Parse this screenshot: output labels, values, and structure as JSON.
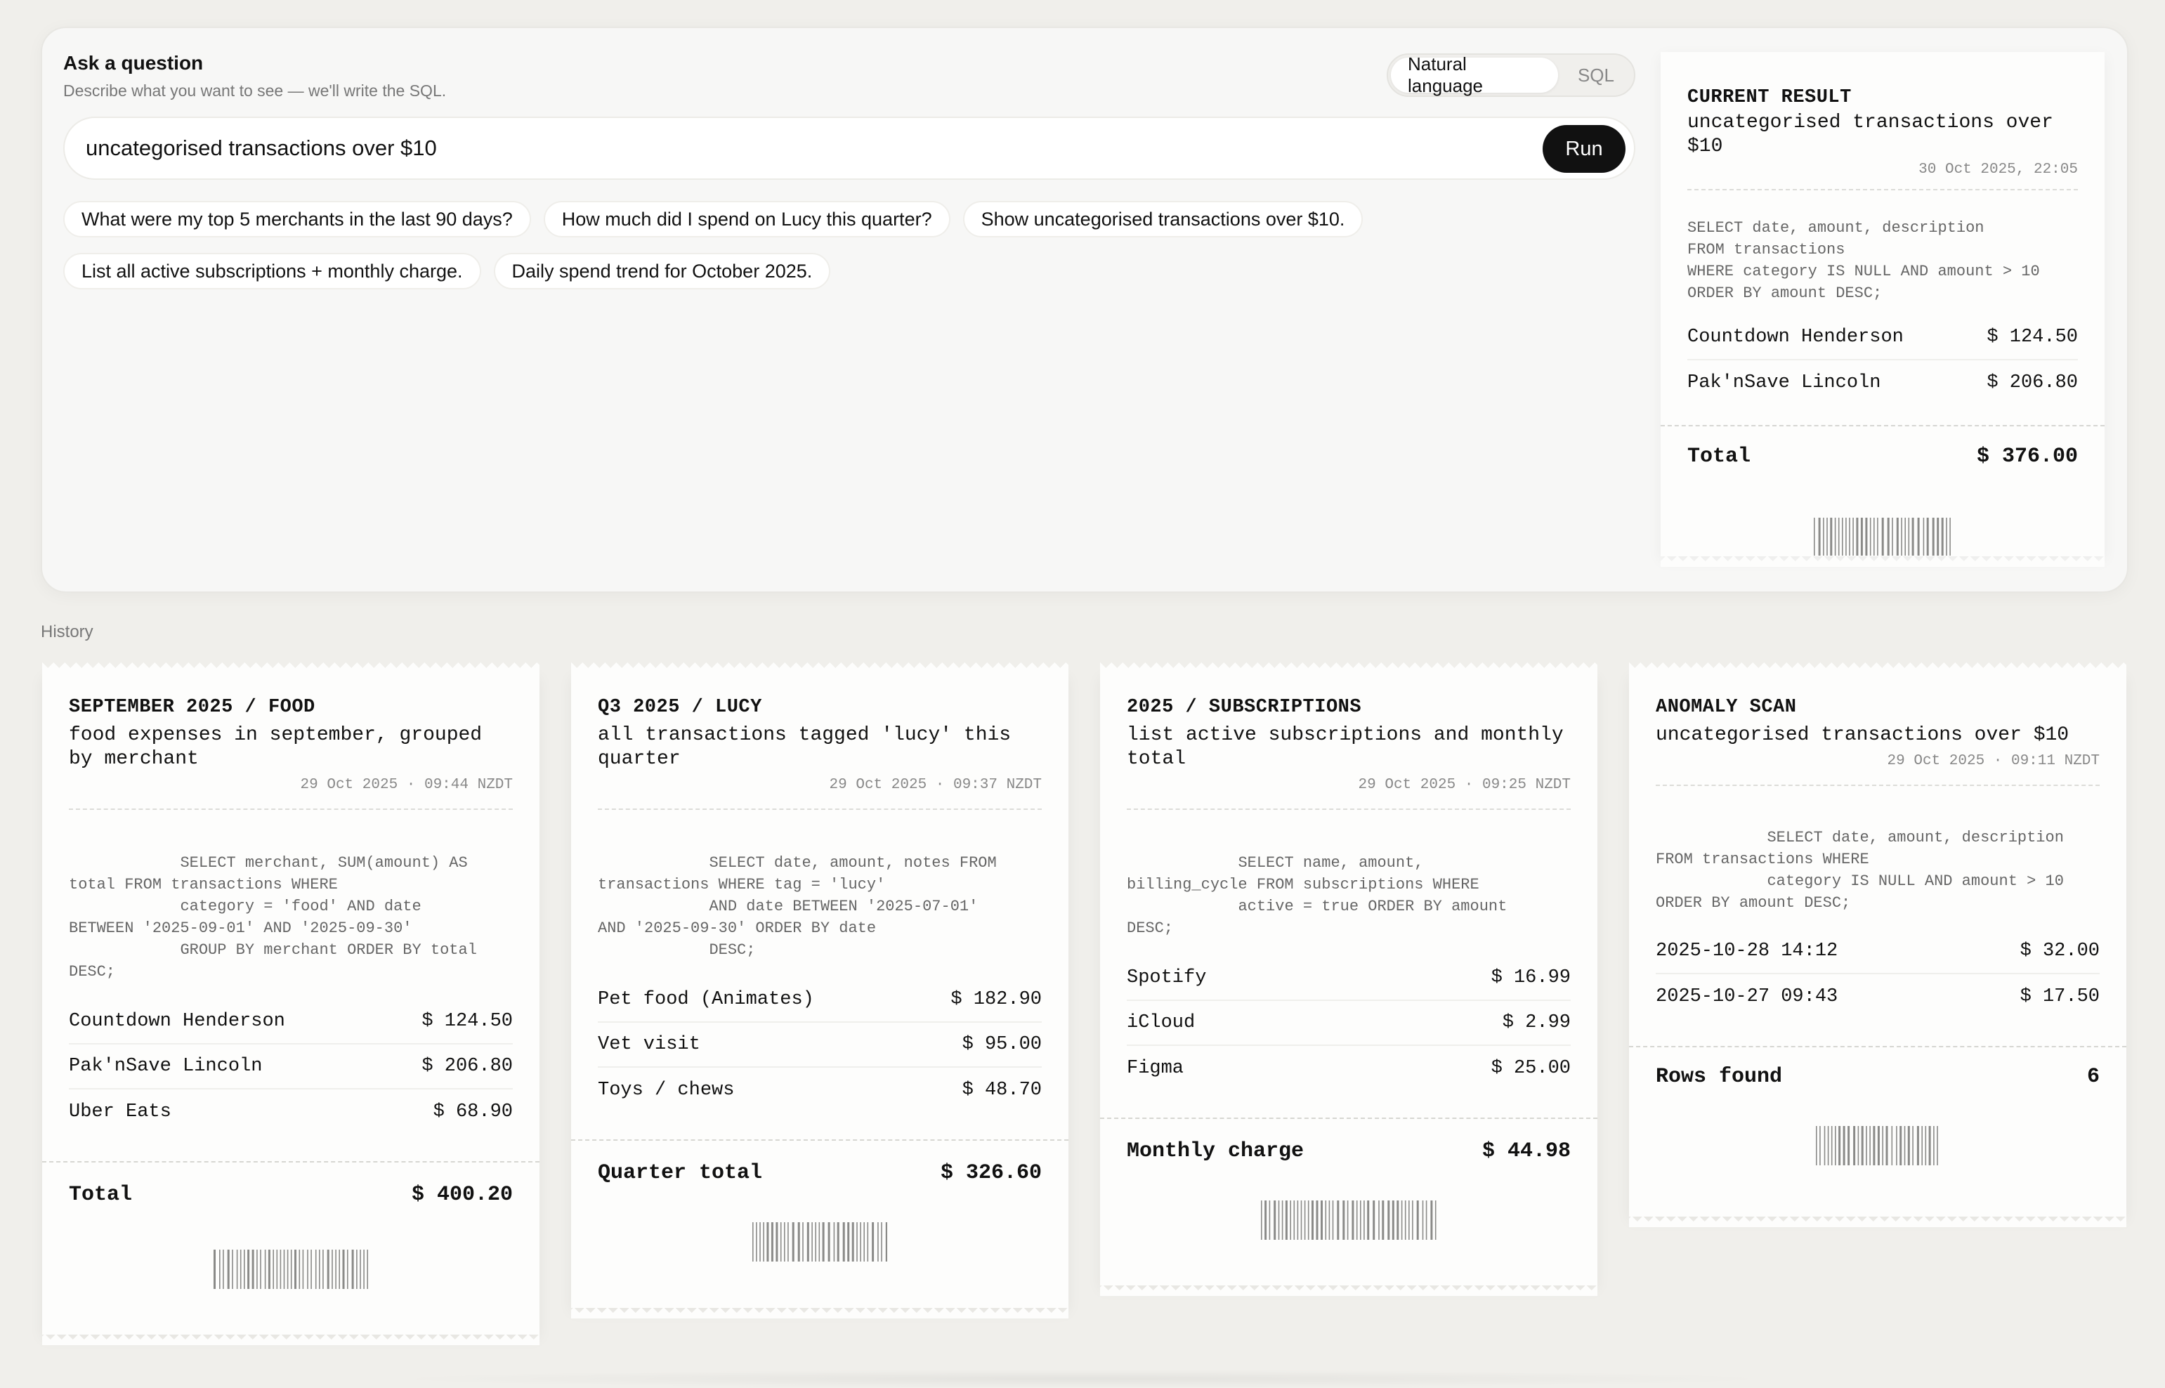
{
  "ask": {
    "title": "Ask a question",
    "subtitle": "Describe what you want to see — we'll write the SQL.",
    "mode_natural": "Natural language",
    "mode_sql": "SQL",
    "query": "uncategorised transactions over $10",
    "run_label": "Run",
    "suggestions": [
      "What were my top 5 merchants in the last 90 days?",
      "How much did I spend on Lucy this quarter?",
      "Show uncategorised transactions over $10.",
      "List all active subscriptions + monthly charge.",
      "Daily spend trend for October 2025."
    ]
  },
  "current": {
    "kicker": "CURRENT RESULT",
    "title": "uncategorised transactions over $10",
    "time": "30 Oct 2025, 22:05",
    "sql": "SELECT date, amount, description\nFROM transactions\nWHERE category IS NULL AND amount > 10\nORDER BY amount DESC;",
    "rows": [
      {
        "label": "Countdown Henderson",
        "amount": "$ 124.50"
      },
      {
        "label": "Pak'nSave Lincoln",
        "amount": "$ 206.80"
      }
    ],
    "total_label": "Total",
    "total_value": "$ 376.00"
  },
  "history_label": "History",
  "history": [
    {
      "kicker": "SEPTEMBER 2025 / FOOD",
      "title": "food expenses in september, grouped by merchant",
      "time": "29 Oct 2025 · 09:44 NZDT",
      "sql": "            SELECT merchant, SUM(amount) AS\ntotal FROM transactions WHERE\n            category = 'food' AND date\nBETWEEN '2025-09-01' AND '2025-09-30'\n            GROUP BY merchant ORDER BY total\nDESC;",
      "rows": [
        {
          "label": "Countdown Henderson",
          "amount": "$ 124.50"
        },
        {
          "label": "Pak'nSave Lincoln",
          "amount": "$ 206.80"
        },
        {
          "label": "Uber Eats",
          "amount": "$ 68.90"
        }
      ],
      "total_label": "Total",
      "total_value": "$ 400.20"
    },
    {
      "kicker": "Q3 2025 / LUCY",
      "title": "all transactions tagged 'lucy' this quarter",
      "time": "29 Oct 2025 · 09:37 NZDT",
      "sql": "            SELECT date, amount, notes FROM\ntransactions WHERE tag = 'lucy'\n            AND date BETWEEN '2025-07-01'\nAND '2025-09-30' ORDER BY date\n            DESC;",
      "rows": [
        {
          "label": "Pet food (Animates)",
          "amount": "$ 182.90"
        },
        {
          "label": "Vet visit",
          "amount": "$ 95.00"
        },
        {
          "label": "Toys / chews",
          "amount": "$ 48.70"
        }
      ],
      "total_label": "Quarter total",
      "total_value": "$ 326.60"
    },
    {
      "kicker": "2025 / SUBSCRIPTIONS",
      "title": "list active subscriptions and monthly total",
      "time": "29 Oct 2025 · 09:25 NZDT",
      "sql": "            SELECT name, amount,\nbilling_cycle FROM subscriptions WHERE\n            active = true ORDER BY amount\nDESC;",
      "rows": [
        {
          "label": "Spotify",
          "amount": "$ 16.99"
        },
        {
          "label": "iCloud",
          "amount": "$ 2.99"
        },
        {
          "label": "Figma",
          "amount": "$ 25.00"
        }
      ],
      "total_label": "Monthly charge",
      "total_value": "$ 44.98"
    },
    {
      "kicker": "ANOMALY SCAN",
      "title": "uncategorised transactions over $10",
      "time": "29 Oct 2025 · 09:11 NZDT",
      "sql": "            SELECT date, amount, description\nFROM transactions WHERE\n            category IS NULL AND amount > 10\nORDER BY amount DESC;",
      "rows": [
        {
          "label": "2025-10-28 14:12",
          "amount": "$ 32.00"
        },
        {
          "label": "2025-10-27 09:43",
          "amount": "$ 17.50"
        }
      ],
      "total_label": "Rows found",
      "total_value": "6"
    }
  ]
}
